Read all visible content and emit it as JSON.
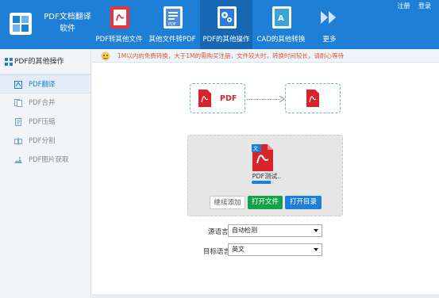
{
  "app": {
    "title": "PDF文档翻译软件",
    "title_line1": "PDF文档翻译",
    "title_line2": "软件"
  },
  "top_links": {
    "register": "注册",
    "login": "登录"
  },
  "nav": {
    "items": [
      {
        "label": "PDF转其他文件",
        "icon": "pdf-to-file-icon",
        "color": "#e8343a"
      },
      {
        "label": "其他文件转PDF",
        "icon": "file-to-pdf-icon",
        "color": "#4a8fe0"
      },
      {
        "label": "PDF的其他操作",
        "icon": "gear-icon",
        "color": "#2c7be0",
        "active": true
      },
      {
        "label": "CAD的其他转换",
        "icon": "cad-icon",
        "color": "#3aa3d8"
      },
      {
        "label": "更多",
        "icon": "double-arrow-icon"
      }
    ]
  },
  "sidebar": {
    "header": "PDF的其他操作",
    "items": [
      {
        "label": "PDF翻译",
        "icon": "translate-icon",
        "active": true
      },
      {
        "label": "PDF合并",
        "icon": "merge-icon"
      },
      {
        "label": "PDF压缩",
        "icon": "compress-icon"
      },
      {
        "label": "PDF分割",
        "icon": "split-icon"
      },
      {
        "label": "PDF图片获取",
        "icon": "image-extract-icon"
      }
    ]
  },
  "notice": {
    "text": "1M以内的免费转换，大于1M的需购买注册，文件较大时，转换时间较长，请耐心等待",
    "icon": "mascot-icon"
  },
  "conversion": {
    "source_label": "PDF",
    "source_icon": "pdf-file-icon",
    "target_icon": "translated-pdf-icon",
    "arrow_icon": "arrow-right-icon"
  },
  "file": {
    "name": "PDF测试..",
    "icon": "pdf-file-icon",
    "progress": 0.85
  },
  "buttons": {
    "add": "继续添加",
    "open_file": "打开文件",
    "open_dir": "打开目录"
  },
  "fields": {
    "source_lang_label": "源语言",
    "source_lang_value": "自动检测",
    "target_lang_label": "目标语言",
    "target_lang_value": "英文"
  },
  "colors": {
    "header_bg": "#1e7fd6",
    "active_nav_bg": "#1566b3",
    "open_file_btn": "#14a34a",
    "open_dir_btn": "#1e7fd6",
    "notice_text": "#e0572c",
    "pdf_red": "#d9232a"
  }
}
